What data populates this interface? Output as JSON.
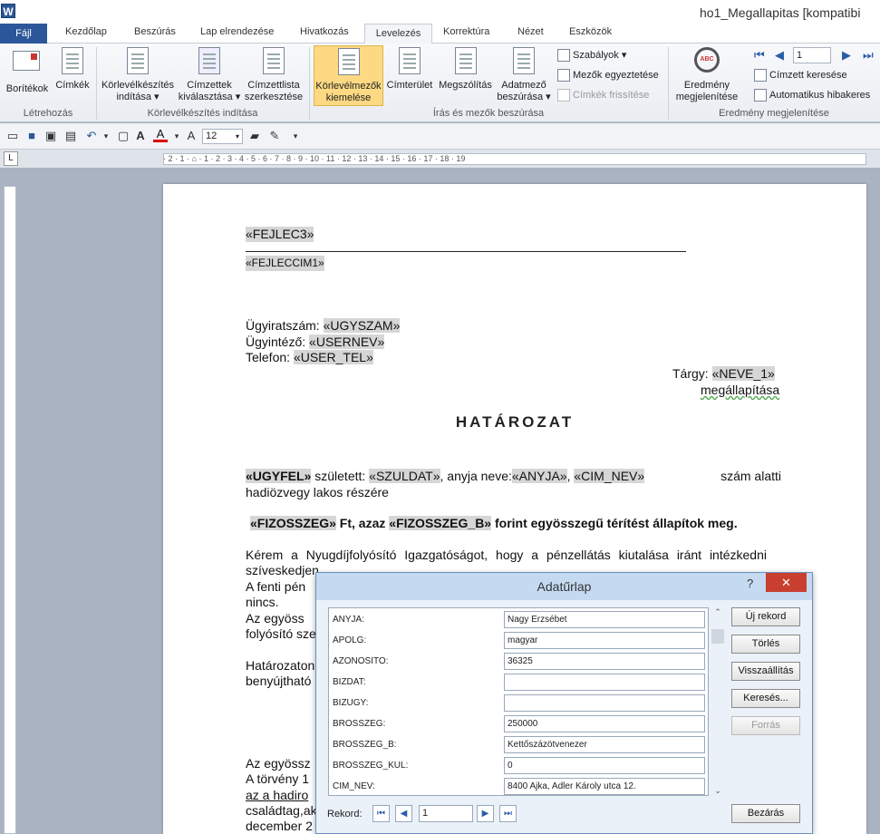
{
  "window": {
    "title": "ho1_Megallapitas [kompatibi",
    "app_icon": "W"
  },
  "tabs": [
    "Fájl",
    "Kezdőlap",
    "Beszúrás",
    "Lap elrendezése",
    "Hivatkozás",
    "Levelezés",
    "Korrektúra",
    "Nézet",
    "Eszközök"
  ],
  "ribbon": {
    "envelopes": "Borítékok",
    "labels": "Címkék",
    "start_merge_1": "Körlevélkészítés",
    "start_merge_2": "indítása",
    "select_recip_1": "Címzettek",
    "select_recip_2": "kiválasztása",
    "edit_list_1": "Címzettlista",
    "edit_list_2": "szerkesztése",
    "highlight_1": "Körlevélmezők",
    "highlight_2": "kiemelése",
    "address_block": "Címterület",
    "greeting": "Megszólítás",
    "insert_field_1": "Adatmező",
    "insert_field_2": "beszúrása",
    "rules": "Szabályok",
    "match_fields": "Mezők egyeztetése",
    "update_labels": "Címkék frissítése",
    "preview_1": "Eredmény",
    "preview_2": "megjelenítése",
    "record_no": "1",
    "find_recipient": "Címzett keresése",
    "auto_check": "Automatikus hibakeres",
    "group_create": "Létrehozás",
    "group_start": "Körlevélkészítés indítása",
    "group_write": "Írás és mezők beszúrása",
    "group_preview": "Eredmény megjelenítése"
  },
  "qat": {
    "font_size": "12"
  },
  "ruler": {
    "numbers": "· 2 · 1 · ⌂ · 1 · 2 · 3 · 4 · 5 · 6 · 7 · 8 · 9 · 10 · 11 · 12 · 13 · 14 · 15 · 16 · 17 · 18 · 19"
  },
  "doc": {
    "fejlec3": "«FEJLEC3»",
    "fejleccim1": "«FEJLECCIM1»",
    "ugyirat_lbl": "Ügyiratszám: ",
    "ugyszam": "«UGYSZAM»",
    "ugyintezo_lbl": "Ügyintéző: ",
    "usernev": "«USERNEV»",
    "telefon_lbl": "Telefon: ",
    "user_tel": "«USER_TEL»",
    "targy_lbl": "Tárgy: ",
    "neve_1": "«NEVE_1»",
    "megallapitasa": "megállapítása",
    "title": "HATÁROZAT",
    "ugyfel": "«UGYFEL»",
    "szuletett": " született: ",
    "szuldat": "«SZULDAT»",
    "anyja_neve": ", anyja neve:",
    "anyja": "«ANYJA»",
    "comma": ", ",
    "cim_nev": "«CIM_NEV»",
    "szam_alatti": " szám alatti",
    "line2": "hadiözvegy lakos részére",
    "fizosszeg": "«FIZOSSZEG»",
    "ft_azaz": " Ft, azaz ",
    "fizosszeg_b": "«FIZOSSZEG_B»",
    "forint_text": " forint egyösszegű térítést állapítok meg.",
    "kerem": "Kérem a Nyugdíjfolyósító Igazgatóságot, hogy a pénzellátás kiutalása iránt intézkedni",
    "sziveskedjen": "szíveskedjen.",
    "fenti": "A fenti pén",
    "nincs": "nincs.",
    "az_egyoss": "Az egyöss",
    "folyosito": "folyósító sze",
    "hatarozat": "Határozaton",
    "benyujthato": "benyújtható",
    "az_egyossz": "Az egyössz",
    "a_torveny": "A törvény 1",
    "az_a_hadiro": "az a hadiro",
    "csaladtag": "családtag,ak",
    "december": "december 2"
  },
  "dialog": {
    "title": "Adatűrlap",
    "help": "?",
    "close": "✕",
    "fields": [
      {
        "label": "ANYJA:",
        "value": "Nagy Erzsébet"
      },
      {
        "label": "APOLG:",
        "value": "magyar"
      },
      {
        "label": "AZONOSITO:",
        "value": "36325"
      },
      {
        "label": "BIZDAT:",
        "value": ""
      },
      {
        "label": "BIZUGY:",
        "value": ""
      },
      {
        "label": "BROSSZEG:",
        "value": "250000"
      },
      {
        "label": "BROSSZEG_B:",
        "value": "Kettőszázötvenezer"
      },
      {
        "label": "BROSSZEG_KUL:",
        "value": "0"
      },
      {
        "label": "CIM_NEV:",
        "value": "8400 Ajka, Adler Károly  utca 12."
      }
    ],
    "new_record": "Új rekord",
    "delete": "Törlés",
    "restore": "Visszaállítás",
    "find": "Keresés...",
    "source": "Forrás",
    "close_btn": "Bezárás",
    "record_lbl": "Rekord:",
    "record_value": "1"
  }
}
